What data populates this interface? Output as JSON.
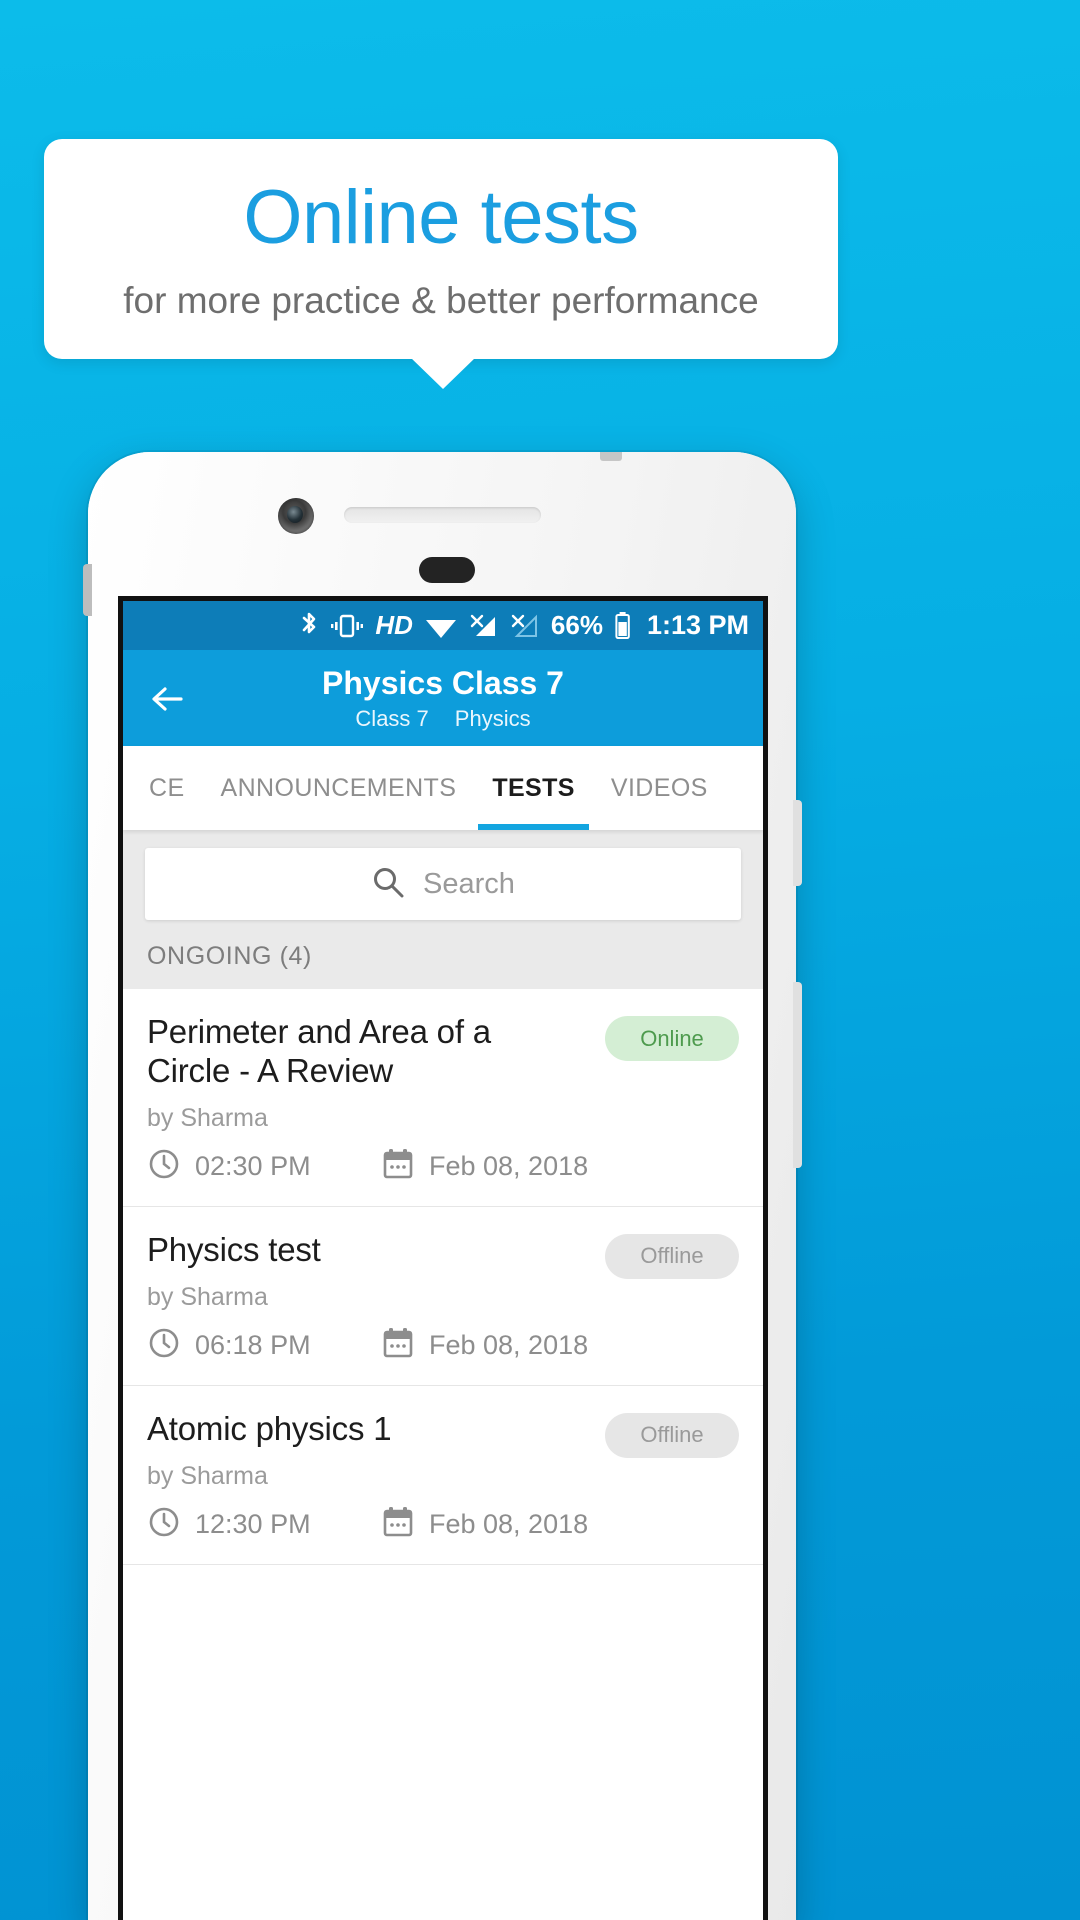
{
  "banner": {
    "title": "Online tests",
    "subtitle": "for more practice & better performance",
    "title_color": "#1b9ee0",
    "subtitle_color": "#6e6e6e",
    "background_color": "#ffffff"
  },
  "page": {
    "background_color": "#06aee4"
  },
  "statusbar": {
    "background_color": "#0d7db8",
    "icons": [
      "bluetooth-icon",
      "vibrate-icon",
      "wifi-icon",
      "signal-1-icon",
      "signal-2-icon"
    ],
    "hd_label": "HD",
    "battery_percent": "66%",
    "time": "1:13 PM"
  },
  "appbar": {
    "background_color": "#0d9ddb",
    "back_icon": "back-arrow-icon",
    "title": "Physics Class 7",
    "subtitle_class": "Class 7",
    "subtitle_subject": "Physics"
  },
  "tabs": [
    {
      "label": "CE",
      "active": false
    },
    {
      "label": "ANNOUNCEMENTS",
      "active": false
    },
    {
      "label": "TESTS",
      "active": true
    },
    {
      "label": "VIDEOS",
      "active": false
    }
  ],
  "active_tab_indicator_color": "#13a5e0",
  "search": {
    "icon": "search-icon",
    "placeholder": "Search",
    "value": ""
  },
  "section": {
    "label": "ONGOING (4)"
  },
  "tests": [
    {
      "title": "Perimeter and Area of a Circle - A Review",
      "author": "by Sharma",
      "time": "02:30 PM",
      "date": "Feb 08, 2018",
      "status": "Online",
      "status_kind": "online",
      "clock_icon": "clock-icon",
      "calendar_icon": "calendar-icon"
    },
    {
      "title": "Physics test",
      "author": "by Sharma",
      "time": "06:18 PM",
      "date": "Feb 08, 2018",
      "status": "Offline",
      "status_kind": "offline",
      "clock_icon": "clock-icon",
      "calendar_icon": "calendar-icon"
    },
    {
      "title": "Atomic physics 1",
      "author": "by Sharma",
      "time": "12:30 PM",
      "date": "Feb 08, 2018",
      "status": "Offline",
      "status_kind": "offline",
      "clock_icon": "clock-icon",
      "calendar_icon": "calendar-icon"
    }
  ],
  "badge_colors": {
    "online_bg": "#d4eed4",
    "online_fg": "#4e9b4e",
    "offline_bg": "#e6e6e6",
    "offline_fg": "#9a9a9a"
  }
}
